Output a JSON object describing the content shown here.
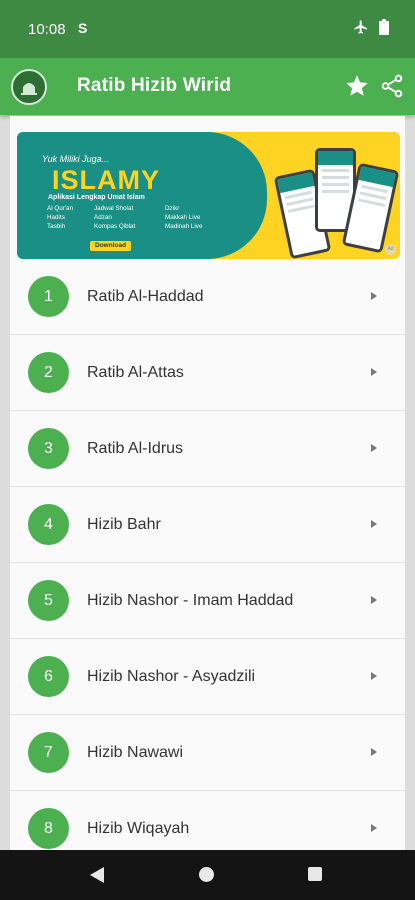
{
  "status_bar": {
    "time": "10:08",
    "indicator": "S",
    "icons": [
      "airplane-mode-icon",
      "battery-icon"
    ]
  },
  "app_bar": {
    "title": "Ratib Hizib Wirid",
    "actions": [
      "star-icon",
      "share-icon"
    ]
  },
  "banner": {
    "kicker": "Yuk Miliki Juga...",
    "title": "ISLAMY",
    "subtitle": "Aplikasi Lengkap Umat Islam",
    "features": [
      "Al Qur'an",
      "Hadits",
      "Tasbih",
      "Jadwal Sholat",
      "Adzan",
      "Kompas Qiblat",
      "Dzikr",
      "Makkah Live",
      "Madinah Live"
    ],
    "download_label": "Download",
    "badge": "Ad"
  },
  "items": [
    {
      "number": "1",
      "label": "Ratib Al-Haddad"
    },
    {
      "number": "2",
      "label": "Ratib Al-Attas"
    },
    {
      "number": "3",
      "label": "Ratib Al-Idrus"
    },
    {
      "number": "4",
      "label": "Hizib Bahr"
    },
    {
      "number": "5",
      "label": "Hizib Nashor - Imam Haddad"
    },
    {
      "number": "6",
      "label": "Hizib Nashor - Asyadzili"
    },
    {
      "number": "7",
      "label": "Hizib Nawawi"
    },
    {
      "number": "8",
      "label": "Hizib Wiqayah"
    }
  ],
  "colors": {
    "status_bar": "#3e8a43",
    "app_bar": "#4caf50",
    "accent": "#4caf50",
    "banner_teal": "#1a8f86",
    "banner_yellow": "#ffd321"
  },
  "nav_bar": {
    "buttons": [
      "back-icon",
      "home-icon",
      "recents-icon"
    ]
  }
}
